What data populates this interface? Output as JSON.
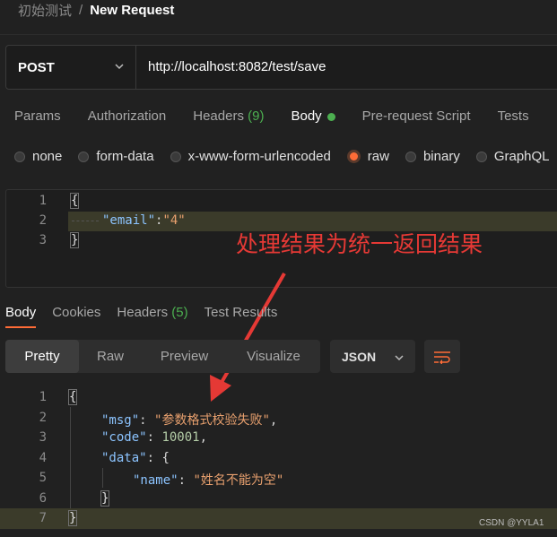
{
  "breadcrumb": {
    "parent": "初始测试",
    "separator": "/",
    "current": "New Request"
  },
  "request": {
    "method": "POST",
    "url": "http://localhost:8082/test/save"
  },
  "request_tabs": [
    {
      "label": "Params"
    },
    {
      "label": "Authorization"
    },
    {
      "label": "Headers",
      "count": "(9)"
    },
    {
      "label": "Body"
    },
    {
      "label": "Pre-request Script"
    },
    {
      "label": "Tests"
    }
  ],
  "body_types": [
    {
      "label": "none"
    },
    {
      "label": "form-data"
    },
    {
      "label": "x-www-form-urlencoded"
    },
    {
      "label": "raw",
      "selected": true
    },
    {
      "label": "binary"
    },
    {
      "label": "GraphQL"
    }
  ],
  "request_body": {
    "line_numbers": [
      "1",
      "2",
      "3"
    ],
    "open": "{",
    "key": "\"email\"",
    "colon": ":",
    "value": "\"4\"",
    "close": "}"
  },
  "annotation": "处理结果为统一返回结果",
  "response_tabs": [
    {
      "label": "Body"
    },
    {
      "label": "Cookies"
    },
    {
      "label": "Headers",
      "count": "(5)"
    },
    {
      "label": "Test Results"
    }
  ],
  "view_modes": [
    "Pretty",
    "Raw",
    "Preview",
    "Visualize"
  ],
  "format": "JSON",
  "response_body": {
    "line_numbers": [
      "1",
      "2",
      "3",
      "4",
      "5",
      "6",
      "7"
    ],
    "open": "{",
    "msg_key": "\"msg\"",
    "msg_value": "\"参数格式校验失败\"",
    "code_key": "\"code\"",
    "code_value": "10001",
    "data_key": "\"data\"",
    "data_open": "{",
    "name_key": "\"name\"",
    "name_value": "\"姓名不能为空\"",
    "data_close": "}",
    "close": "}",
    "colon": ": ",
    "comma": ","
  },
  "watermark": "CSDN @YYLA1",
  "colors": {
    "accent": "#ff6c37",
    "success": "#4caf50",
    "annotation": "#e53935",
    "background": "#212121"
  }
}
